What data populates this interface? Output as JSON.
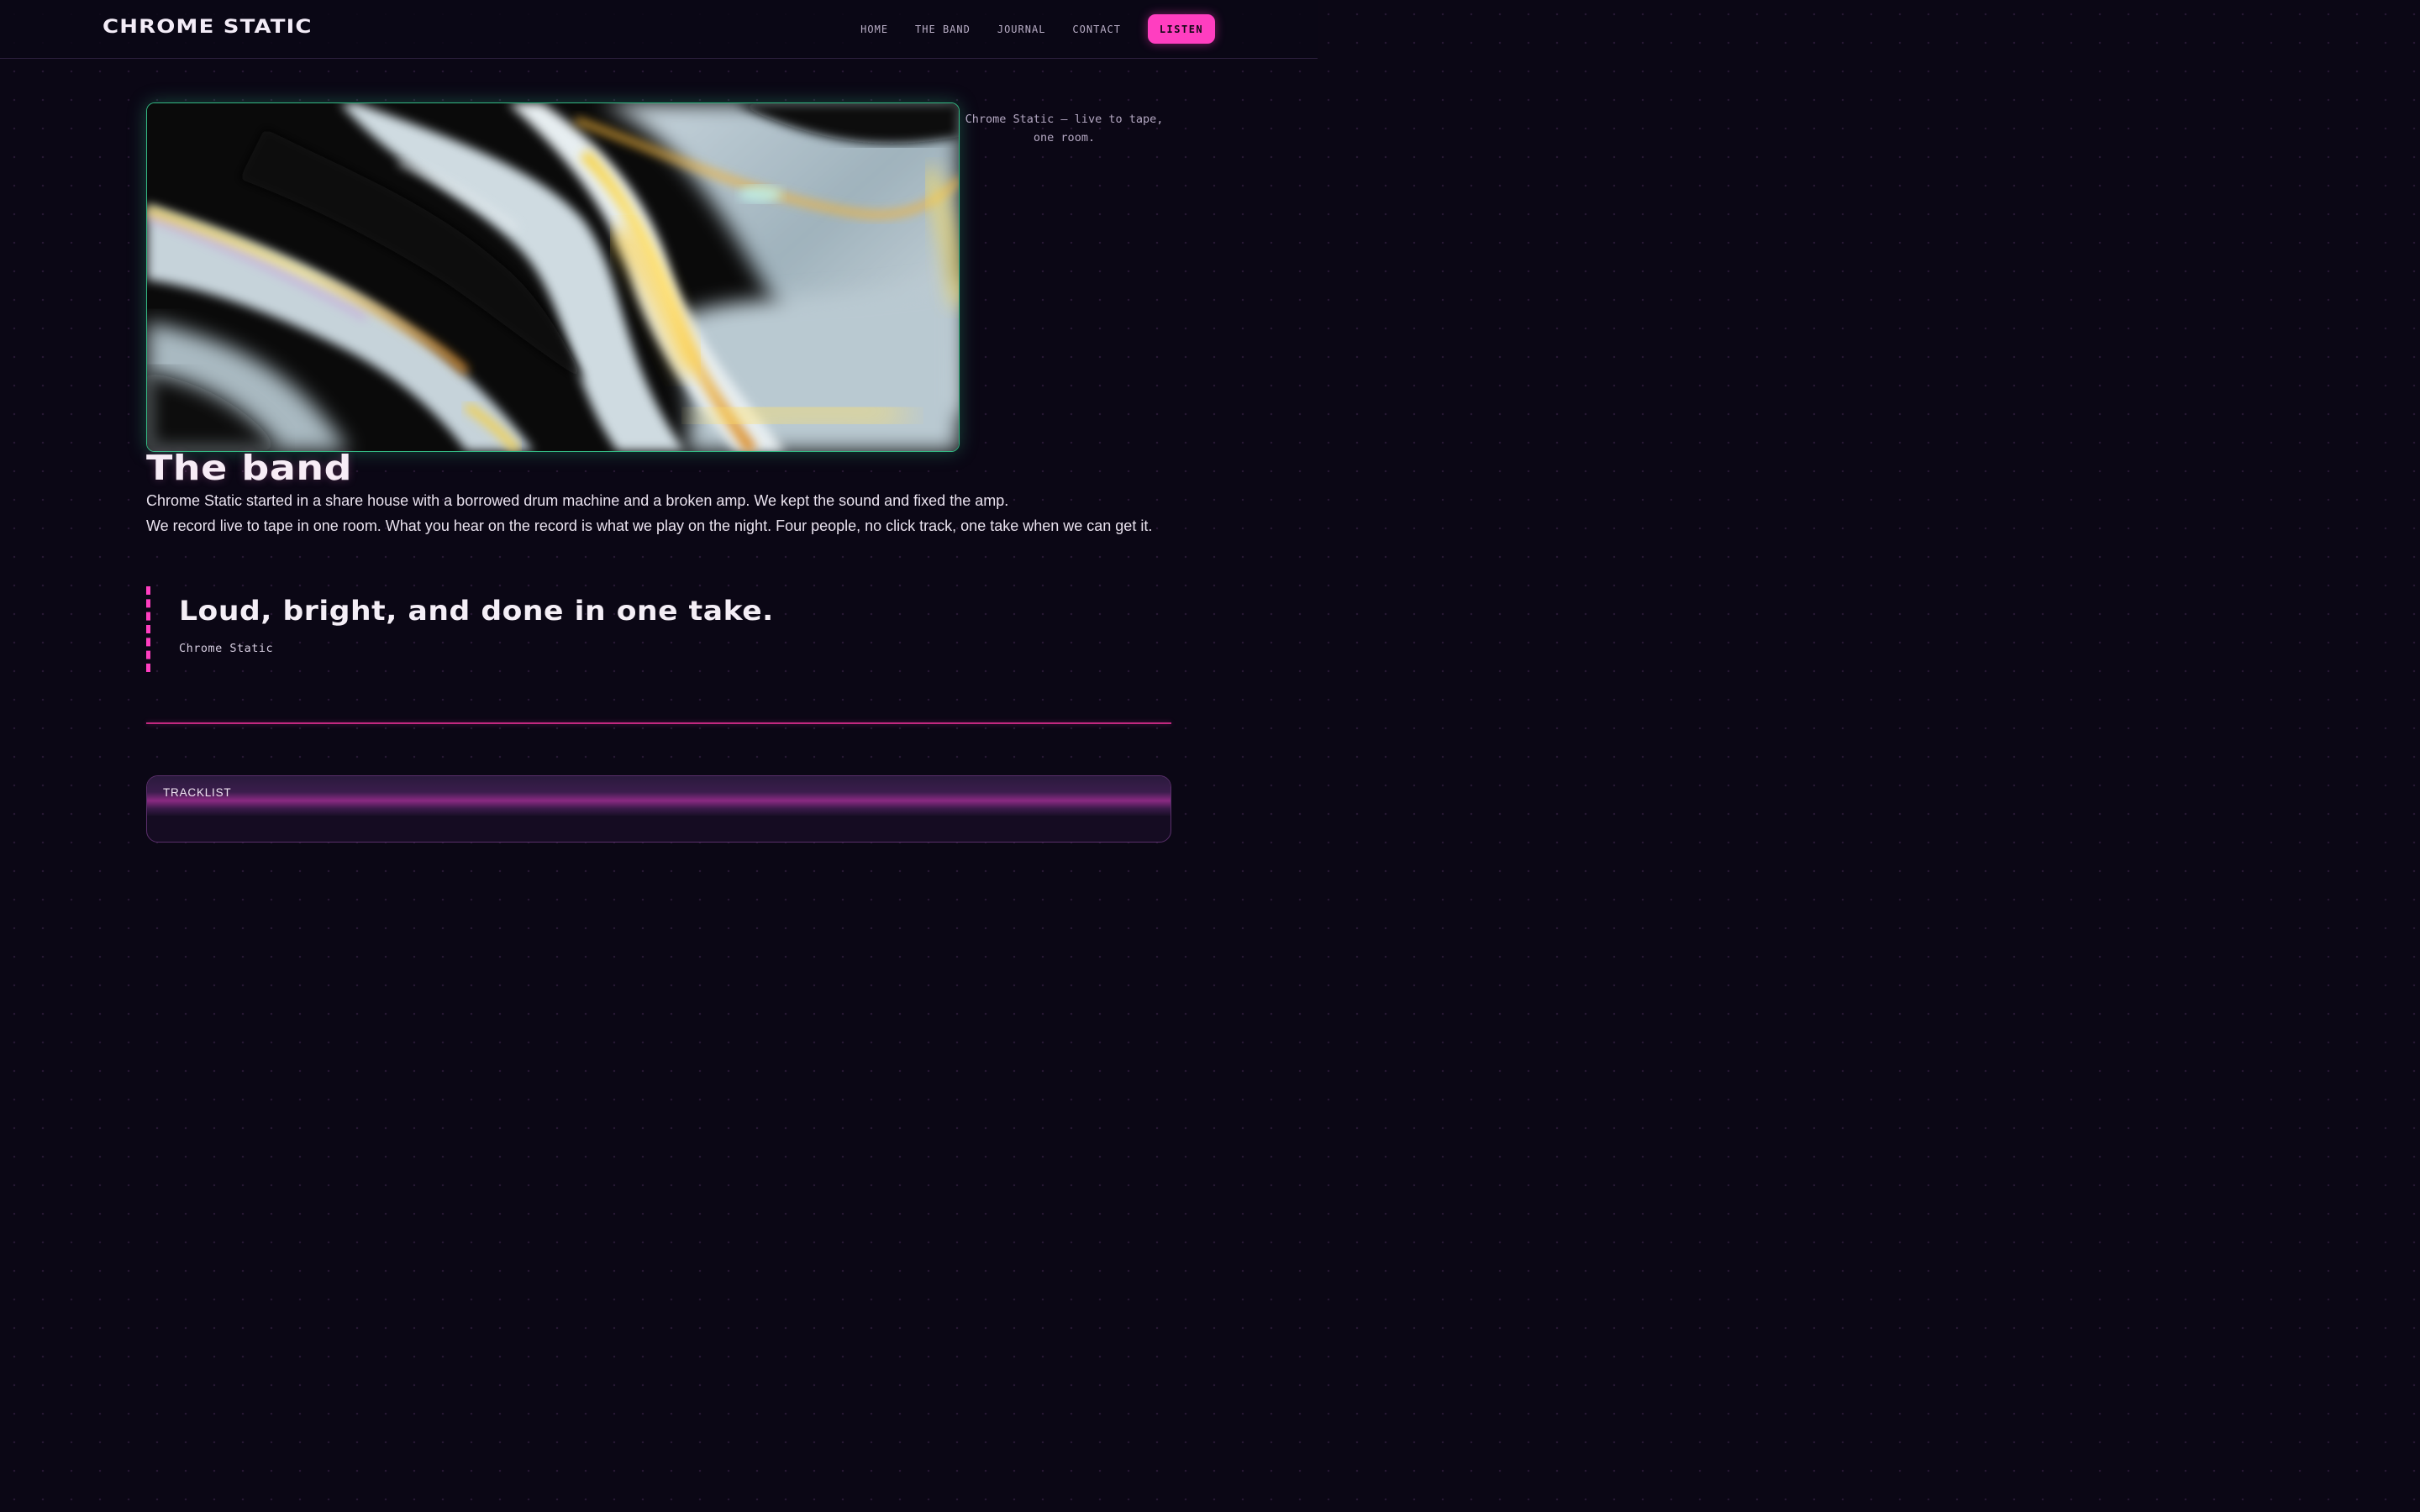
{
  "header": {
    "brand": "CHROME STATIC",
    "nav": [
      {
        "label": "HOME"
      },
      {
        "label": "THE BAND"
      },
      {
        "label": "JOURNAL"
      },
      {
        "label": "CONTACT"
      }
    ],
    "cta_label": "LISTEN"
  },
  "hero": {
    "caption": "Chrome Static — live to tape, one room."
  },
  "band": {
    "title": "The band",
    "paragraphs": [
      "Chrome Static started in a share house with a borrowed drum machine and a broken amp. We kept the sound and fixed the amp.",
      "We record live to tape in one room. What you hear on the record is what we play on the night. Four people, no click track, one take when we can get it."
    ]
  },
  "quote": {
    "text": "Loud, bright, and done in one take.",
    "cite": "Chrome Static"
  },
  "tracklist": {
    "label": "TRACKLIST"
  },
  "colors": {
    "background": "#0b0715",
    "accent_pink": "#ff3ec0",
    "accent_green": "#33b883",
    "text": "#efe8f4"
  }
}
